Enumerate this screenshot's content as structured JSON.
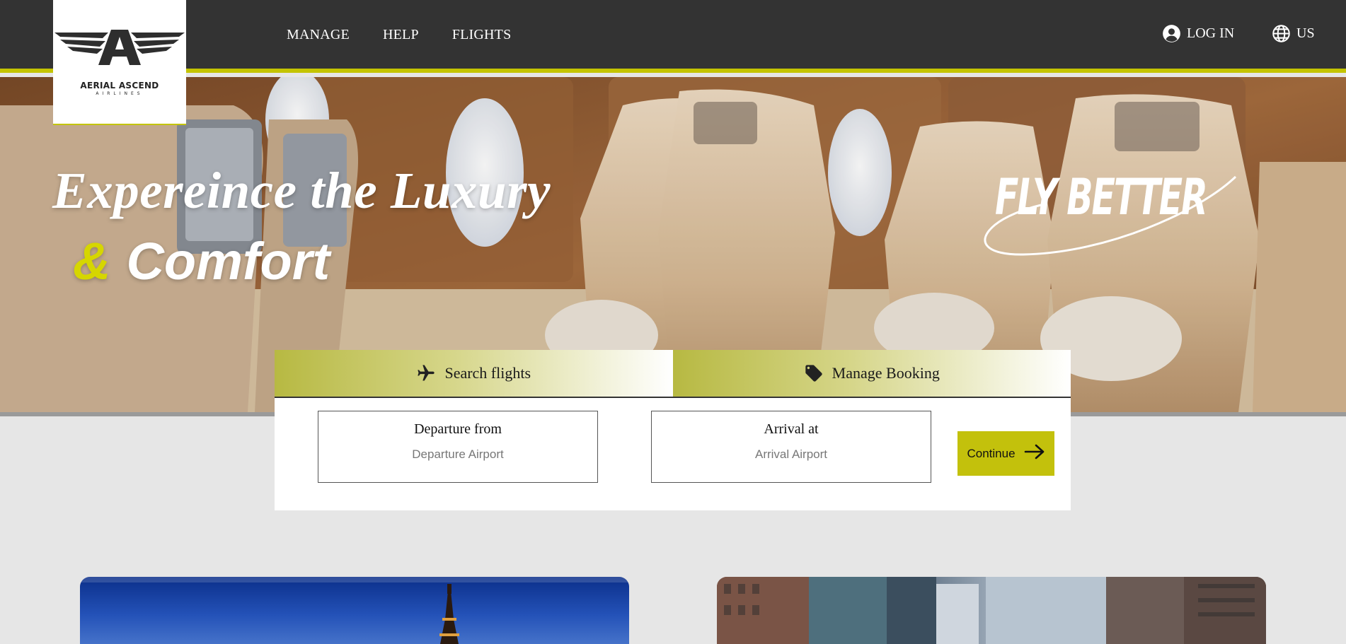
{
  "brand": {
    "name": "AERIAL ASCEND",
    "subname": "AIRLINES",
    "accent_color": "#c4c400",
    "nav_bg": "#333333"
  },
  "nav": {
    "links": [
      "MANAGE",
      "HELP",
      "FLIGHTS"
    ],
    "login": {
      "label": "LOG IN",
      "icon": "user-circle-icon"
    },
    "locale": {
      "label": "US",
      "icon": "globe-icon"
    }
  },
  "hero": {
    "headline_1": "Expereince the Luxury",
    "headline_2_amp": "&",
    "headline_2": "Comfort",
    "tagline": "FLY BETTER"
  },
  "booking": {
    "tabs": [
      {
        "label": "Search flights",
        "icon": "airplane-icon"
      },
      {
        "label": "Manage Booking",
        "icon": "tag-icon"
      }
    ],
    "departure": {
      "label": "Departure from",
      "placeholder": "Departure Airport"
    },
    "arrival": {
      "label": "Arrival at",
      "placeholder": "Arrival Airport"
    },
    "continue": {
      "label": "Continue",
      "icon": "arrow-right-icon"
    }
  }
}
